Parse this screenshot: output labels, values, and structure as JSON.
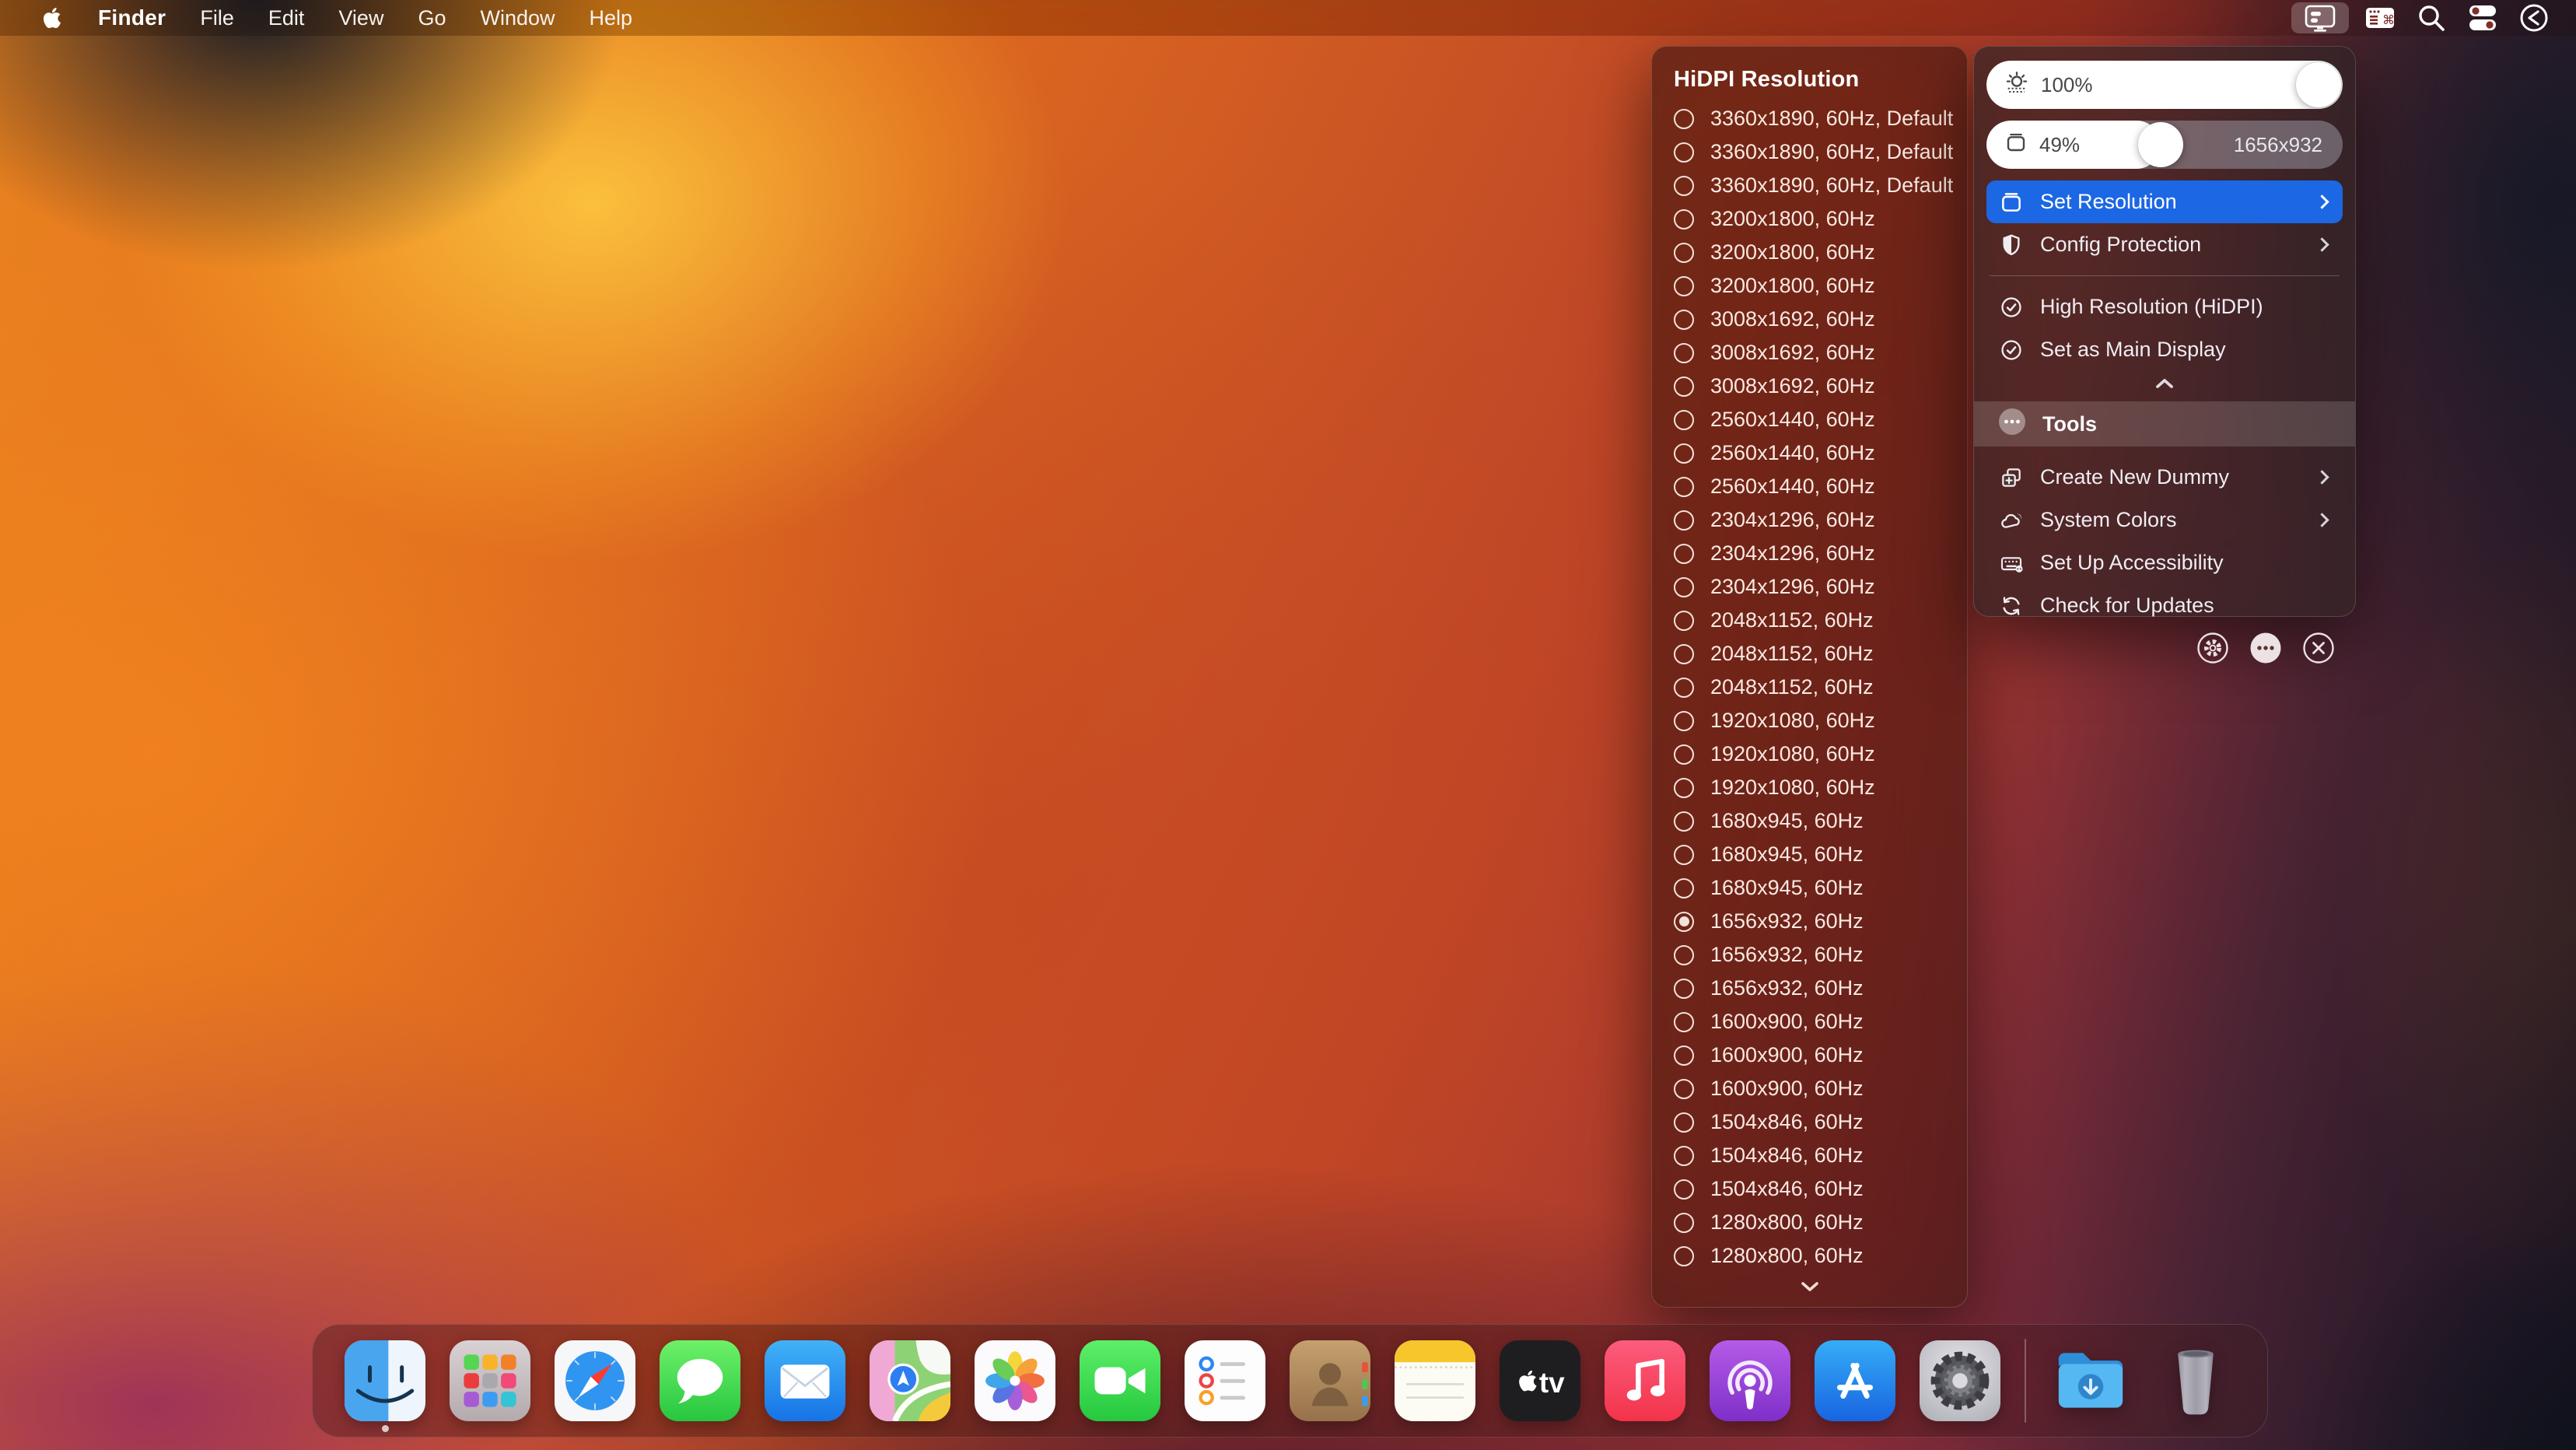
{
  "menu_bar": {
    "app_name": "Finder",
    "menus": [
      "File",
      "Edit",
      "View",
      "Go",
      "Window",
      "Help"
    ],
    "status_icons": [
      "display",
      "keyboard-command",
      "search",
      "control-center",
      "clock"
    ]
  },
  "resolution_panel": {
    "title": "HiDPI Resolution",
    "items": [
      {
        "label": "3360x1890, 60Hz, Default",
        "selected": false
      },
      {
        "label": "3360x1890, 60Hz, Default",
        "selected": false
      },
      {
        "label": "3360x1890, 60Hz, Default",
        "selected": false
      },
      {
        "label": "3200x1800, 60Hz",
        "selected": false
      },
      {
        "label": "3200x1800, 60Hz",
        "selected": false
      },
      {
        "label": "3200x1800, 60Hz",
        "selected": false
      },
      {
        "label": "3008x1692, 60Hz",
        "selected": false
      },
      {
        "label": "3008x1692, 60Hz",
        "selected": false
      },
      {
        "label": "3008x1692, 60Hz",
        "selected": false
      },
      {
        "label": "2560x1440, 60Hz",
        "selected": false
      },
      {
        "label": "2560x1440, 60Hz",
        "selected": false
      },
      {
        "label": "2560x1440, 60Hz",
        "selected": false
      },
      {
        "label": "2304x1296, 60Hz",
        "selected": false
      },
      {
        "label": "2304x1296, 60Hz",
        "selected": false
      },
      {
        "label": "2304x1296, 60Hz",
        "selected": false
      },
      {
        "label": "2048x1152, 60Hz",
        "selected": false
      },
      {
        "label": "2048x1152, 60Hz",
        "selected": false
      },
      {
        "label": "2048x1152, 60Hz",
        "selected": false
      },
      {
        "label": "1920x1080, 60Hz",
        "selected": false
      },
      {
        "label": "1920x1080, 60Hz",
        "selected": false
      },
      {
        "label": "1920x1080, 60Hz",
        "selected": false
      },
      {
        "label": "1680x945, 60Hz",
        "selected": false
      },
      {
        "label": "1680x945, 60Hz",
        "selected": false
      },
      {
        "label": "1680x945, 60Hz",
        "selected": false
      },
      {
        "label": "1656x932, 60Hz",
        "selected": true
      },
      {
        "label": "1656x932, 60Hz",
        "selected": false
      },
      {
        "label": "1656x932, 60Hz",
        "selected": false
      },
      {
        "label": "1600x900, 60Hz",
        "selected": false
      },
      {
        "label": "1600x900, 60Hz",
        "selected": false
      },
      {
        "label": "1600x900, 60Hz",
        "selected": false
      },
      {
        "label": "1504x846, 60Hz",
        "selected": false
      },
      {
        "label": "1504x846, 60Hz",
        "selected": false
      },
      {
        "label": "1504x846, 60Hz",
        "selected": false
      },
      {
        "label": "1280x800, 60Hz",
        "selected": false
      },
      {
        "label": "1280x800, 60Hz",
        "selected": false
      }
    ]
  },
  "control_panel": {
    "brightness_slider": {
      "value_label": "100%",
      "percent": 100
    },
    "resolution_slider": {
      "value_label": "49%",
      "percent": 49,
      "right_label": "1656x932"
    },
    "set_resolution": {
      "label": "Set Resolution"
    },
    "config_protection": {
      "label": "Config Protection"
    },
    "high_resolution": {
      "label": "High Resolution (HiDPI)"
    },
    "set_main_display": {
      "label": "Set as Main Display"
    },
    "tools_header": "Tools",
    "create_new_dummy": {
      "label": "Create New Dummy"
    },
    "system_colors": {
      "label": "System Colors"
    },
    "set_up_accessibility": {
      "label": "Set Up Accessibility"
    },
    "check_for_updates": {
      "label": "Check for Updates"
    }
  },
  "dock": {
    "apps": [
      "Finder",
      "Launchpad",
      "Safari",
      "Messages",
      "Mail",
      "Maps",
      "Photos",
      "FaceTime",
      "Reminders",
      "Contacts",
      "Notes",
      "TV",
      "Music",
      "Podcasts",
      "App Store",
      "System Settings",
      "Downloads",
      "Trash"
    ],
    "tv_label": "tv"
  },
  "colors": {
    "accent_blue": "#1c67e3",
    "list_panel_tint": "rgba(66,26,20,0.66)",
    "control_panel_tint": "rgba(47,36,38,0.72)"
  }
}
